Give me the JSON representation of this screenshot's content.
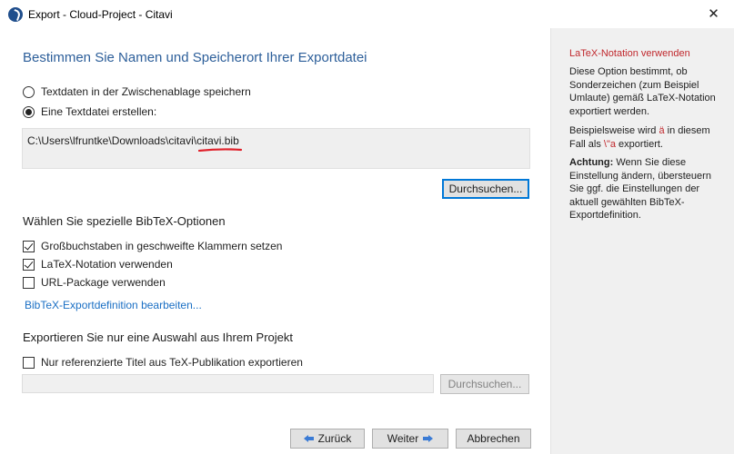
{
  "window": {
    "title": "Export - Cloud-Project - Citavi",
    "close_symbol": "✕"
  },
  "main": {
    "heading": "Bestimmen Sie Namen und Speicherort Ihrer Exportdatei",
    "radio_clipboard": "Textdaten in der Zwischenablage speichern",
    "radio_textfile": "Eine Textdatei erstellen:",
    "path_prefix": "C:\\Users\\lfruntke\\Downloads\\citavi\\",
    "path_file": "citavi.bib",
    "browse_label": "Durchsuchen...",
    "bibtex_section": "Wählen Sie spezielle BibTeX-Optionen",
    "opt_uppercase": "Großbuchstaben in geschweifte Klammern setzen",
    "opt_latex": "LaTeX-Notation verwenden",
    "opt_url": "URL-Package verwenden",
    "edit_link": "BibTeX-Exportdefinition bearbeiten...",
    "selection_section": "Exportieren Sie nur eine Auswahl aus Ihrem Projekt",
    "opt_referenced": "Nur referenzierte Titel aus TeX-Publikation exportieren",
    "browse2_label": "Durchsuchen..."
  },
  "footer": {
    "back_label": "Zurück",
    "next_label": "Weiter",
    "cancel_label": "Abbrechen"
  },
  "help": {
    "title": "LaTeX-Notation verwenden",
    "para1": "Diese Option bestimmt, ob Sonderzeichen (zum Beispiel Umlaute) gemäß LaTeX-Notation exportiert werden.",
    "para2_before": "Beispielsweise wird ",
    "para2_char": "ä",
    "para2_middle": " in diesem Fall als ",
    "para2_code": "\\\"a",
    "para2_after": " exportiert.",
    "para3_bold": "Achtung:",
    "para3_rest": " Wenn Sie diese Einstellung ändern, übersteuern Sie ggf. die Einstellungen der aktuell gewählten BibTeX-Exportdefinition."
  },
  "state": {
    "radio_clipboard_selected": false,
    "radio_textfile_selected": true,
    "opt_uppercase_checked": true,
    "opt_latex_checked": true,
    "opt_url_checked": false,
    "opt_referenced_checked": false
  },
  "colors": {
    "heading": "#2d5f9a",
    "link": "#1a6fc4",
    "help_accent": "#c0282d",
    "annotation": "#e0202a"
  },
  "icons": {
    "app": "citavi-logo-icon",
    "close": "close-icon",
    "back": "arrow-left-icon",
    "next": "arrow-right-icon"
  }
}
